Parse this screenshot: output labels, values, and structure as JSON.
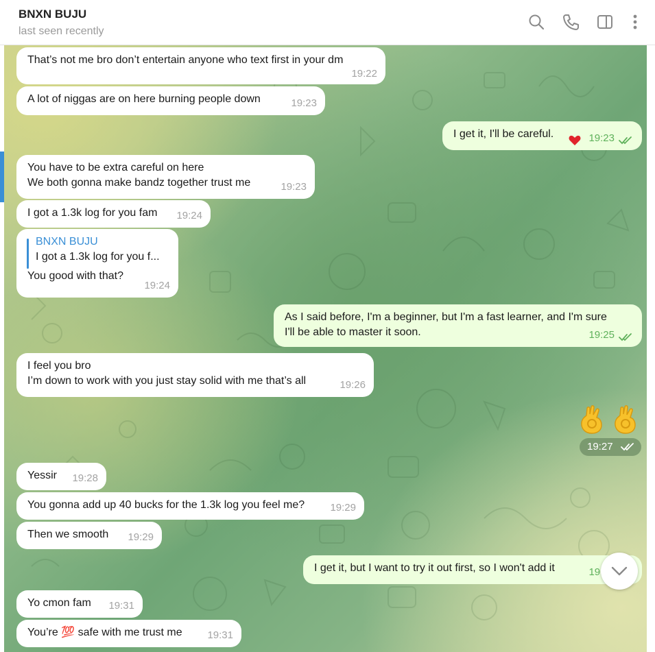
{
  "header": {
    "name": "BNXN BUJU",
    "status": "last seen recently",
    "icons": [
      "search-icon",
      "phone-icon",
      "sidebar-toggle-icon",
      "more-vertical-icon"
    ]
  },
  "colors": {
    "incoming_bubble": "#ffffff",
    "outgoing_bubble": "#eeffde",
    "accent": "#3a8fd6",
    "outgoing_time": "#5fb15b"
  },
  "messages": [
    {
      "text": "That’s not me bro don’t entertain anyone who text first in your dm",
      "time": "19:22"
    },
    {
      "text": "A lot of niggas are on here burning people down",
      "time": "19:23"
    },
    {
      "text": "I get it, I'll be careful.",
      "time": "19:23",
      "reaction": "heart"
    },
    {
      "text": "You have to be extra careful on here\nWe both gonna make bandz together trust me",
      "time": "19:23"
    },
    {
      "text": "I got a 1.3k log for you fam",
      "time": "19:24"
    },
    {
      "reply_name": "BNXN BUJU",
      "reply_text": "I got a 1.3k log for you f...",
      "text": "You good with that?",
      "time": "19:24"
    },
    {
      "text": "As I said before, I'm a beginner, but I'm a fast learner, and I'm sure\nI'll be able to master it soon.",
      "time": "19:25"
    },
    {
      "text": "I feel you bro\nI’m down to work with you just stay solid with me that’s all",
      "time": "19:26"
    },
    {
      "sticker": "👌👌",
      "time": "19:27"
    },
    {
      "text": "Yessir",
      "time": "19:28"
    },
    {
      "text": "You gonna add up 40 bucks for the 1.3k log you feel me?",
      "time": "19:29"
    },
    {
      "text": "Then we smooth",
      "time": "19:29"
    },
    {
      "text": "I get it, but I want to try it out first, so I won't add it",
      "time": "19:31"
    },
    {
      "text": "Yo cmon fam",
      "time": "19:31"
    },
    {
      "text_before": "You’re",
      "emoji": "💯",
      "text_after": "safe with me trust me",
      "time": "19:31"
    }
  ]
}
